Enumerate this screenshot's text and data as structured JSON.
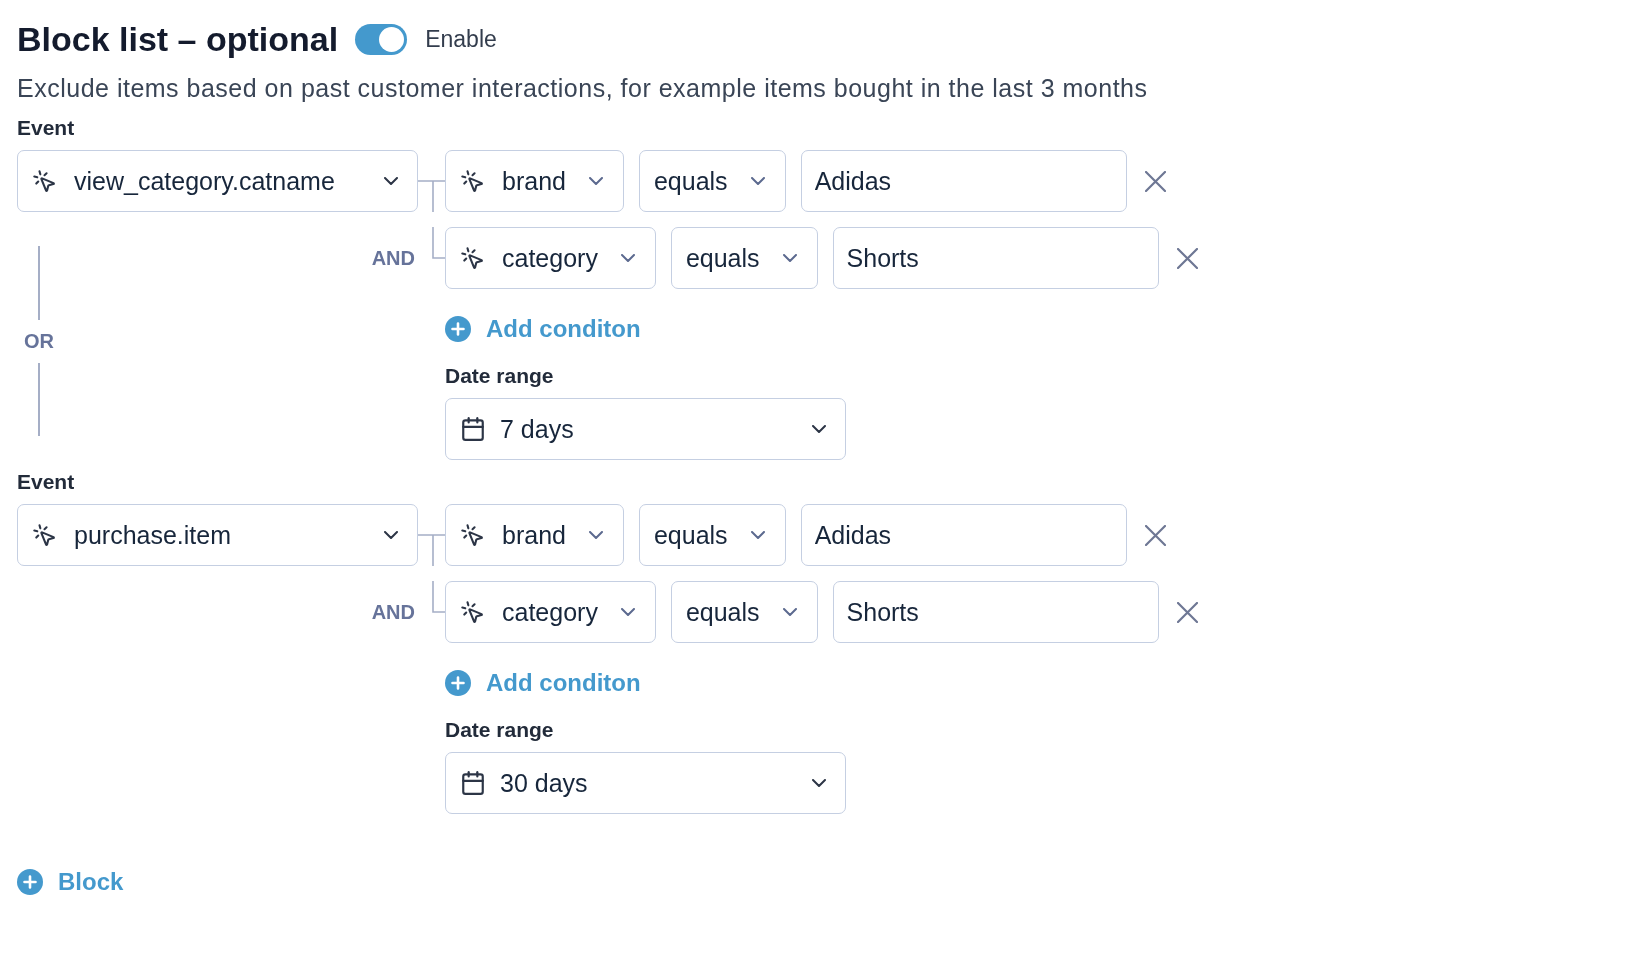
{
  "header": {
    "title": "Block list – optional",
    "toggle": {
      "label": "Enable",
      "on": true
    },
    "description": "Exclude items based on past customer interactions, for example items bought in the last 3 months"
  },
  "blocks": [
    {
      "event_label": "Event",
      "event": "view_category.catname",
      "conditions": [
        {
          "field": "brand",
          "operator": "equals",
          "value": "Adidas"
        },
        {
          "joiner": "AND",
          "field": "category",
          "operator": "equals",
          "value": "Shorts"
        }
      ],
      "add_condition": "Add conditon",
      "date_range_label": "Date range",
      "date_range": "7 days",
      "separator": "OR"
    },
    {
      "event_label": "Event",
      "event": "purchase.item",
      "conditions": [
        {
          "field": "brand",
          "operator": "equals",
          "value": "Adidas"
        },
        {
          "joiner": "AND",
          "field": "category",
          "operator": "equals",
          "value": "Shorts"
        }
      ],
      "add_condition": "Add conditon",
      "date_range_label": "Date range",
      "date_range": "30 days"
    }
  ],
  "add_block": "Block"
}
